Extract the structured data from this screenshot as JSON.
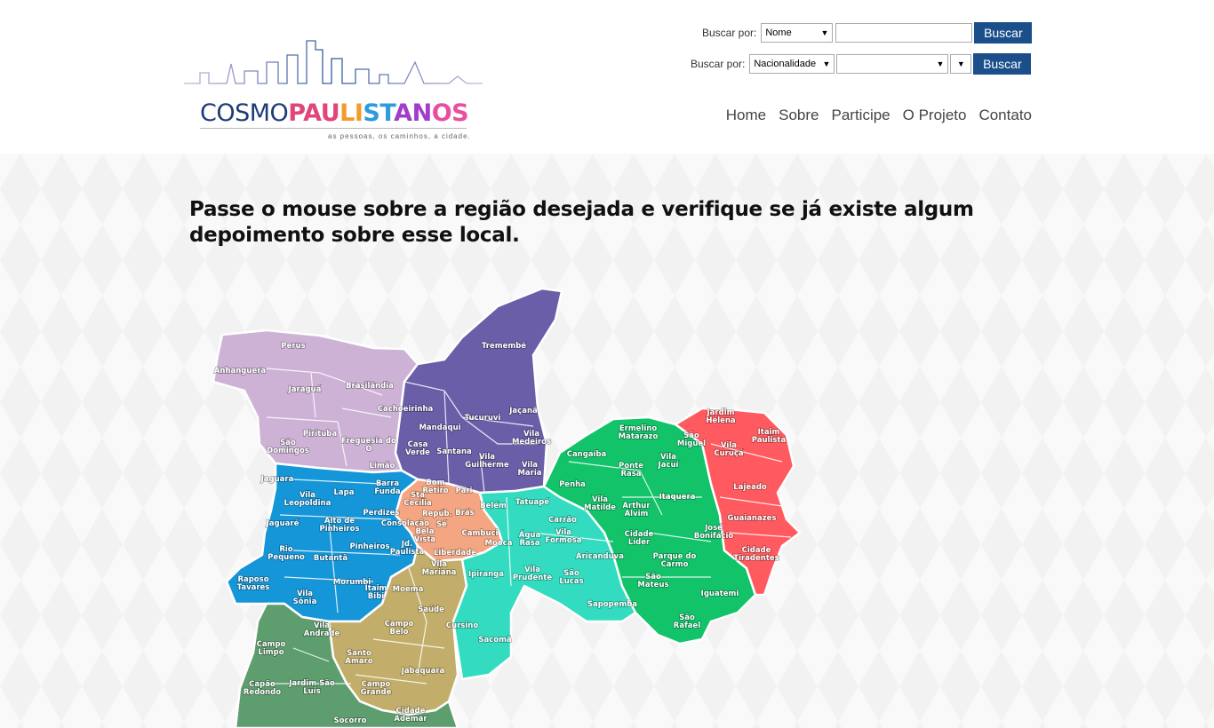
{
  "brand": {
    "part1": "COSMO",
    "part2": "PAULISTANOS",
    "tagline": "as pessoas, os caminhos, a cidade.",
    "colors": {
      "dark": "#1d3c78",
      "accent_gradient": [
        "#e0457b",
        "#f39a2b",
        "#2e9bdc",
        "#a23ccc",
        "#e84fa0"
      ]
    }
  },
  "search": {
    "row1": {
      "label": "Buscar por:",
      "select_value": "Nome",
      "input_value": "",
      "button": "Buscar"
    },
    "row2": {
      "label": "Buscar por:",
      "select_value": "Nacionalidade",
      "select2_value": "",
      "select3_value": "",
      "button": "Buscar"
    }
  },
  "nav": {
    "items": [
      "Home",
      "Sobre",
      "Participe",
      "O Projeto",
      "Contato"
    ]
  },
  "main": {
    "instruction": "Passe o mouse sobre a região desejada e verifique se já existe algum depoimento sobre esse local."
  },
  "map": {
    "region_colors": {
      "norte_oeste": "#cdb2d6",
      "norte": "#6b5ea8",
      "oeste": "#1596d9",
      "centro": "#f4a582",
      "centro_sul": "#c2ae6a",
      "sudeste": "#33dcc0",
      "leste1": "#12c36a",
      "leste2": "#ff5a5f",
      "sul": "#5e9e6e"
    },
    "districts": [
      {
        "name": "Perus",
        "region": "norte_oeste"
      },
      {
        "name": "Anhanguera",
        "region": "norte_oeste"
      },
      {
        "name": "Jaraguá",
        "region": "norte_oeste"
      },
      {
        "name": "Brasilândia",
        "region": "norte_oeste"
      },
      {
        "name": "Pirituba",
        "region": "norte_oeste"
      },
      {
        "name": "São Domingos",
        "region": "norte_oeste"
      },
      {
        "name": "Freguesia do Ó",
        "region": "norte_oeste"
      },
      {
        "name": "Limão",
        "region": "norte_oeste"
      },
      {
        "name": "Tremembé",
        "region": "norte"
      },
      {
        "name": "Cachoeirinha",
        "region": "norte"
      },
      {
        "name": "Mandaqui",
        "region": "norte"
      },
      {
        "name": "Tucuruvi",
        "region": "norte"
      },
      {
        "name": "Jaçanã",
        "region": "norte"
      },
      {
        "name": "Casa Verde",
        "region": "norte"
      },
      {
        "name": "Santana",
        "region": "norte"
      },
      {
        "name": "Vila Medeiros",
        "region": "norte"
      },
      {
        "name": "Vila Guilherme",
        "region": "norte"
      },
      {
        "name": "Vila Maria",
        "region": "norte"
      },
      {
        "name": "Jaguara",
        "region": "oeste"
      },
      {
        "name": "Lapa",
        "region": "oeste"
      },
      {
        "name": "Barra Funda",
        "region": "oeste"
      },
      {
        "name": "Vila Leopoldina",
        "region": "oeste"
      },
      {
        "name": "Perdizes",
        "region": "oeste"
      },
      {
        "name": "Jaguaré",
        "region": "oeste"
      },
      {
        "name": "Alto de Pinheiros",
        "region": "oeste"
      },
      {
        "name": "Pinheiros",
        "region": "oeste"
      },
      {
        "name": "Rio Pequeno",
        "region": "oeste"
      },
      {
        "name": "Butantã",
        "region": "oeste"
      },
      {
        "name": "Raposo Tavares",
        "region": "oeste"
      },
      {
        "name": "Morumbi",
        "region": "oeste"
      },
      {
        "name": "Vila Sônia",
        "region": "oeste"
      },
      {
        "name": "Itaim Bibi",
        "region": "oeste"
      },
      {
        "name": "Jd. Paulista",
        "region": "oeste"
      },
      {
        "name": "Bom Retiro",
        "region": "centro"
      },
      {
        "name": "Pari",
        "region": "centro"
      },
      {
        "name": "Sta Cecília",
        "region": "centro"
      },
      {
        "name": "Repúb.",
        "region": "centro"
      },
      {
        "name": "Brás",
        "region": "centro"
      },
      {
        "name": "Consolação",
        "region": "centro"
      },
      {
        "name": "Sé",
        "region": "centro"
      },
      {
        "name": "Bela Vista",
        "region": "centro"
      },
      {
        "name": "Liberdade",
        "region": "centro"
      },
      {
        "name": "Cambuci",
        "region": "centro"
      },
      {
        "name": "Vila Mariana",
        "region": "centro_sul"
      },
      {
        "name": "Moema",
        "region": "centro_sul"
      },
      {
        "name": "Saúde",
        "region": "centro_sul"
      },
      {
        "name": "Campo Belo",
        "region": "centro_sul"
      },
      {
        "name": "Santo Amaro",
        "region": "centro_sul"
      },
      {
        "name": "Jabaquara",
        "region": "centro_sul"
      },
      {
        "name": "Campo Grande",
        "region": "centro_sul"
      },
      {
        "name": "Belém",
        "region": "sudeste"
      },
      {
        "name": "Tatuapé",
        "region": "sudeste"
      },
      {
        "name": "Carrão",
        "region": "sudeste"
      },
      {
        "name": "Mooca",
        "region": "sudeste"
      },
      {
        "name": "Água Rasa",
        "region": "sudeste"
      },
      {
        "name": "Vila Formosa",
        "region": "sudeste"
      },
      {
        "name": "Ipiranga",
        "region": "sudeste"
      },
      {
        "name": "Vila Prudente",
        "region": "sudeste"
      },
      {
        "name": "São Lucas",
        "region": "sudeste"
      },
      {
        "name": "Sapopemba",
        "region": "sudeste"
      },
      {
        "name": "Cursino",
        "region": "sudeste"
      },
      {
        "name": "Sacomã",
        "region": "sudeste"
      },
      {
        "name": "Ermelino Matarazo",
        "region": "leste1"
      },
      {
        "name": "Cangaíba",
        "region": "leste1"
      },
      {
        "name": "Ponte Rasa",
        "region": "leste1"
      },
      {
        "name": "Penha",
        "region": "leste1"
      },
      {
        "name": "Vila Matilde",
        "region": "leste1"
      },
      {
        "name": "Arthur Alvim",
        "region": "leste1"
      },
      {
        "name": "Itaquera",
        "region": "leste1"
      },
      {
        "name": "Cidade Líder",
        "region": "leste1"
      },
      {
        "name": "José Bonifácio",
        "region": "leste1"
      },
      {
        "name": "Aricanduva",
        "region": "leste1"
      },
      {
        "name": "Parque do Carmo",
        "region": "leste1"
      },
      {
        "name": "São Mateus",
        "region": "leste1"
      },
      {
        "name": "Iguatemi",
        "region": "leste1"
      },
      {
        "name": "São Rafael",
        "region": "leste1"
      },
      {
        "name": "Jardim Helena",
        "region": "leste2"
      },
      {
        "name": "São Miguel",
        "region": "leste2"
      },
      {
        "name": "Itaim Paulista",
        "region": "leste2"
      },
      {
        "name": "Vila Curuçá",
        "region": "leste2"
      },
      {
        "name": "Vila Jacuí",
        "region": "leste2"
      },
      {
        "name": "Lajeado",
        "region": "leste2"
      },
      {
        "name": "Guaianazes",
        "region": "leste2"
      },
      {
        "name": "Cidade Tiradentes",
        "region": "leste2"
      },
      {
        "name": "Vila Andrade",
        "region": "sul"
      },
      {
        "name": "Campo Limpo",
        "region": "sul"
      },
      {
        "name": "Capão Redondo",
        "region": "sul"
      },
      {
        "name": "Jardim São Luís",
        "region": "sul"
      },
      {
        "name": "Socorro",
        "region": "sul"
      },
      {
        "name": "Cidade Ademar",
        "region": "sul"
      }
    ]
  }
}
